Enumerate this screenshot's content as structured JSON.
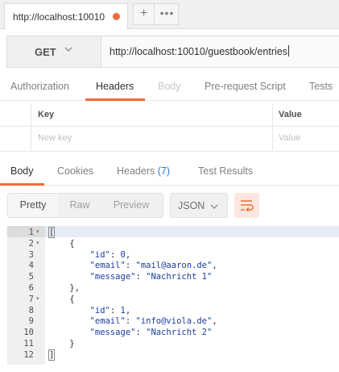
{
  "tab": {
    "title": "http://localhost:10010",
    "plus": "+",
    "more": "•••"
  },
  "request": {
    "method": "GET",
    "url": "http://localhost:10010/guestbook/entries"
  },
  "request_tabs": [
    "Authorization",
    "Headers",
    "Body",
    "Pre-request Script",
    "Tests"
  ],
  "params": {
    "key_header": "Key",
    "value_header": "Value",
    "key_placeholder": "New key",
    "value_placeholder": "Value"
  },
  "response_tabs": {
    "body": "Body",
    "cookies": "Cookies",
    "headers": "Headers",
    "headers_count": "(7)",
    "test_results": "Test Results"
  },
  "format": {
    "pretty": "Pretty",
    "raw": "Raw",
    "preview": "Preview",
    "language": "JSON"
  },
  "icons": {
    "method_dropdown": "chevron-down-icon",
    "lang_dropdown": "chevron-down-icon",
    "wrap": "wrap-lines-icon",
    "unsaved": "unsaved-dot-icon"
  },
  "colors": {
    "accent": "#f26b3a",
    "link": "#2a7ae2",
    "code": "#1c3ba0"
  },
  "code": {
    "line_numbers": [
      "1",
      "2",
      "3",
      "4",
      "5",
      "6",
      "7",
      "8",
      "9",
      "10",
      "11",
      "12"
    ],
    "lines": [
      "[",
      "    {",
      "        \"id\": 0,",
      "        \"email\": \"mail@aaron.de\",",
      "        \"message\": \"Nachricht 1\"",
      "    },",
      "    {",
      "        \"id\": 1,",
      "        \"email\": \"info@viola.de\",",
      "        \"message\": \"Nachricht 2\"",
      "    }",
      "]"
    ]
  }
}
